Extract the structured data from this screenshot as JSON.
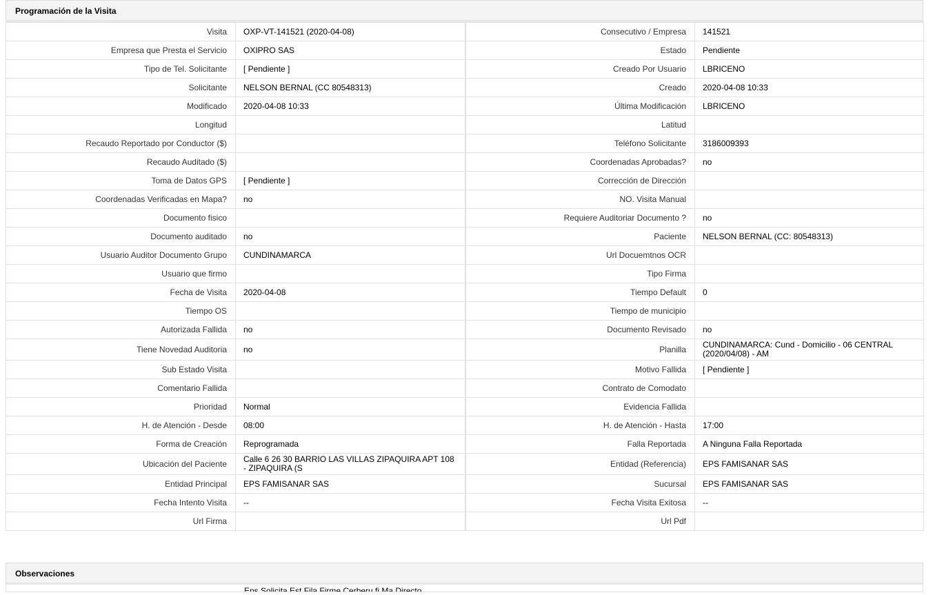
{
  "visit_section": {
    "title": "Programación de la Visita",
    "rows": [
      {
        "l1": "Visita",
        "v1": "OXP-VT-141521 (2020-04-08)",
        "l2": "Consecutivo / Empresa",
        "v2": "141521"
      },
      {
        "l1": "Empresa que Presta el Servicio",
        "v1": "OXIPRO SAS",
        "l2": "Estado",
        "v2": "Pendiente"
      },
      {
        "l1": "Tipo de Tel. Solicitante",
        "v1": "[ Pendiente ]",
        "l2": "Creado Por Usuario",
        "v2": "LBRICENO"
      },
      {
        "l1": "Solicitante",
        "v1": "NELSON BERNAL (CC 80548313)",
        "l2": "Creado",
        "v2": "2020-04-08 10:33"
      },
      {
        "l1": "Modificado",
        "v1": "2020-04-08 10:33",
        "l2": "Última Modificación",
        "v2": " LBRICENO"
      },
      {
        "l1": "Longitud",
        "v1": "",
        "l2": "Latitud",
        "v2": ""
      },
      {
        "l1": "Recaudo Reportado por Conductor ($)",
        "v1": "",
        "l2": "Teléfono Solicitante",
        "v2": "3186009393"
      },
      {
        "l1": "Recaudo Auditado ($)",
        "v1": "",
        "l2": "Coordenadas Aprobadas?",
        "v2": " no"
      },
      {
        "l1": "Toma de Datos GPS",
        "v1": "[ Pendiente ]",
        "l2": "Corrección de Dirección",
        "v2": ""
      },
      {
        "l1": "Coordenadas Verificadas en Mapa?",
        "v1": " no",
        "l2": "NO. Visita Manual",
        "v2": ""
      },
      {
        "l1": "Documento fisico",
        "v1": "",
        "l2": "Requiere Auditoriar Documento ?",
        "v2": " no"
      },
      {
        "l1": "Documento auditado",
        "v1": " no",
        "l2": "Paciente",
        "v2": "NELSON BERNAL (CC: 80548313)"
      },
      {
        "l1": "Usuario Auditor Documento Grupo",
        "v1": "CUNDINAMARCA",
        "l2": "Url Docuemtnos OCR",
        "v2": ""
      },
      {
        "l1": "Usuario que firmo",
        "v1": "",
        "l2": "Tipo Firma",
        "v2": ""
      },
      {
        "l1": "Fecha de Visita",
        "v1": " 2020-04-08",
        "l2": "Tiempo Default",
        "v2": "0"
      },
      {
        "l1": "Tiempo OS",
        "v1": "",
        "l2": "Tiempo de municipio",
        "v2": ""
      },
      {
        "l1": "Autorizada Fallida",
        "v1": " no",
        "l2": "Documento Revisado",
        "v2": " no"
      },
      {
        "l1": "Tiene Novedad Auditoria",
        "v1": " no",
        "l2": "Planilla",
        "v2": "CUNDINAMARCA: Cund - Domicilio - 06 CENTRAL (2020/04/08) - AM",
        "tall": true
      },
      {
        "l1": "Sub Estado Visita",
        "v1": "",
        "l2": "Motivo Fallida",
        "v2": "[ Pendiente ]"
      },
      {
        "l1": "Comentario Fallida",
        "v1": "",
        "l2": "Contrato de Comodato",
        "v2": ""
      },
      {
        "l1": "Prioridad",
        "v1": "Normal",
        "l2": "Evidencia Fallida",
        "v2": ""
      },
      {
        "l1": "H. de Atención - Desde",
        "v1": "08:00",
        "l2": "H. de Atención - Hasta",
        "v2": "17:00"
      },
      {
        "l1": "Forma de Creación",
        "v1": "Reprogramada",
        "l2": "Falla Reportada",
        "v2": "A Ninguna Falla Reportada"
      },
      {
        "l1": "Ubicación del Paciente",
        "v1": "Calle 6 26 30 BARRIO LAS VILLAS ZIPAQUIRA APT 108 - ZIPAQUIRA (S",
        "l2": "Entidad (Referencia)",
        "v2": "EPS FAMISANAR SAS",
        "tall": true
      },
      {
        "l1": "Entidad Principal",
        "v1": "EPS FAMISANAR SAS",
        "l2": "Sucursal",
        "v2": "EPS FAMISANAR SAS"
      },
      {
        "l1": "Fecha Intento Visita",
        "v1": " --",
        "l2": "Fecha Visita Exitosa",
        "v2": " --"
      },
      {
        "l1": "Url Firma",
        "v1": "",
        "l2": "Url Pdf",
        "v2": ""
      }
    ]
  },
  "observations_section": {
    "title": "Observaciones",
    "partial_text": "Eps Solicita Est Fila Firme Cerberu fi Ma Directo"
  }
}
